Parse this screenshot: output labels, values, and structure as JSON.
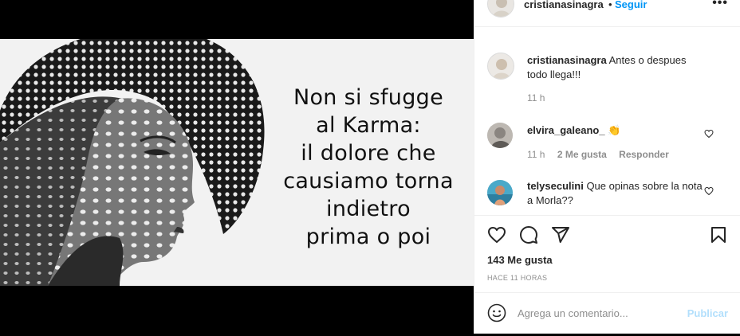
{
  "post": {
    "image": {
      "quote_lines": [
        "Non si sfugge",
        "al Karma:",
        "il dolore che",
        "causiamo torna",
        "indietro",
        "prima o poi"
      ]
    }
  },
  "header": {
    "username": "cristianasinagra",
    "separator": "•",
    "follow_label": "Seguir",
    "more_icon": "more-options-icon"
  },
  "comments": [
    {
      "username": "cristianasinagra",
      "text": "Antes o despues todo llega!!!",
      "time": "11 h",
      "likes": "",
      "reply": ""
    },
    {
      "username": "elvira_galeano_",
      "text": "👏",
      "time": "11 h",
      "likes": "2 Me gusta",
      "reply": "Responder"
    },
    {
      "username": "telyseculini",
      "text": "Que opinas sobre la nota a Morla??",
      "time": "",
      "likes": "",
      "reply": ""
    }
  ],
  "actions": {
    "icons": [
      "heart-icon",
      "comment-icon",
      "share-icon",
      "save-icon"
    ],
    "likes": "143 Me gusta",
    "timestamp": "HACE 11 HORAS"
  },
  "add_comment": {
    "placeholder": "Agrega un comentario...",
    "publish_label": "Publicar"
  },
  "colors": {
    "accent": "#0095f6",
    "publish_disabled": "#b2dffc",
    "text": "#262626",
    "muted": "#8e8e8e"
  }
}
